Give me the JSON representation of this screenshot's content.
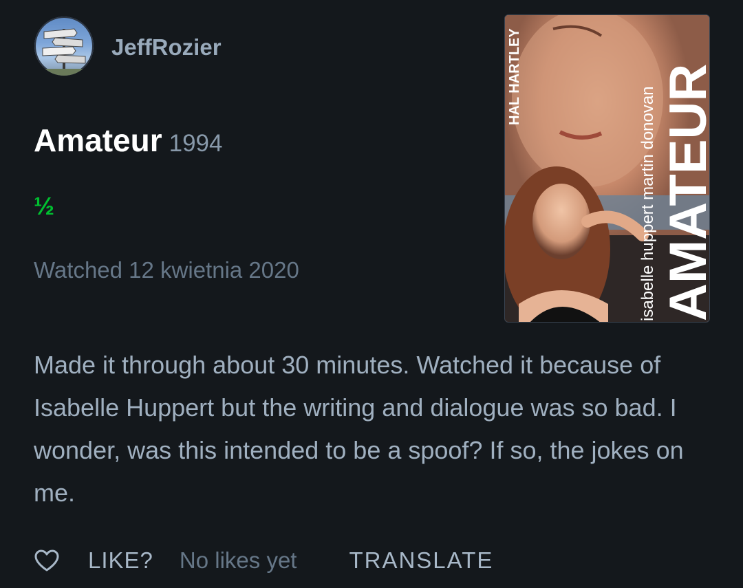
{
  "user": {
    "name": "JeffRozier",
    "avatar_icon": "signpost-avatar"
  },
  "film": {
    "title": "Amateur",
    "year": "1994",
    "rating": "½",
    "watched_text": "Watched 12 kwietnia 2020",
    "poster": {
      "title_text": "AMATEUR",
      "director_text": "HAL HARTLEY",
      "cast_text": "isabelle huppert martin donovan"
    }
  },
  "review": {
    "text": "Made it through about 30 minutes. Watched it because of Isabelle Huppert but the writing and dialogue was so bad. I wonder, was this intended to be a spoof? If so, the jokes on me."
  },
  "footer": {
    "like_icon": "heart-icon",
    "like_label": "LIKE?",
    "likes_count": "No likes yet",
    "translate_label": "TRANSLATE"
  },
  "colors": {
    "background": "#14181c",
    "rating_green": "#00c030",
    "title_white": "#ffffff"
  }
}
